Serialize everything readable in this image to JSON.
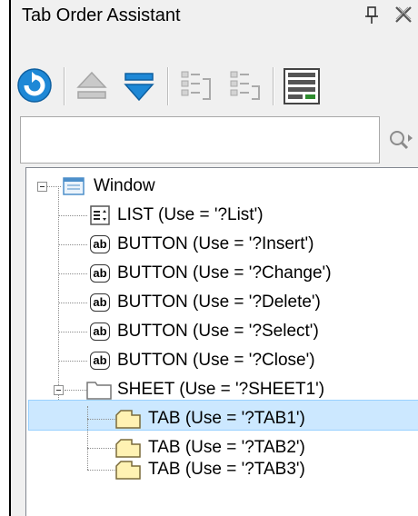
{
  "panel": {
    "title": "Tab Order Assistant",
    "pin_icon": "pin-icon",
    "close_icon": "close-icon"
  },
  "toolbar": {
    "buttons": [
      {
        "name": "refresh-button",
        "icon": "refresh-icon"
      },
      {
        "name": "move-up-button",
        "icon": "arrow-up-icon"
      },
      {
        "name": "move-down-button",
        "icon": "arrow-down-icon"
      },
      {
        "name": "list-button-1",
        "icon": "list-icon"
      },
      {
        "name": "list-button-2",
        "icon": "list-icon"
      },
      {
        "name": "layout-button",
        "icon": "layout-icon"
      }
    ]
  },
  "search": {
    "value": "",
    "placeholder": ""
  },
  "tree": {
    "root": "Window",
    "items": [
      "LIST (Use = '?List')",
      "BUTTON (Use = '?Insert')",
      "BUTTON (Use = '?Change')",
      "BUTTON (Use = '?Delete')",
      "BUTTON (Use = '?Select')",
      "BUTTON (Use = '?Close')",
      "SHEET (Use = '?SHEET1')",
      "TAB (Use = '?TAB1')",
      "TAB (Use = '?TAB2')",
      "TAB (Use = '?TAB3')"
    ],
    "button_icon_text": "ab",
    "selected_index": 7
  },
  "colors": {
    "accent": "#1e88d6",
    "selection": "#cce8ff",
    "folder": "#fff2b3"
  }
}
